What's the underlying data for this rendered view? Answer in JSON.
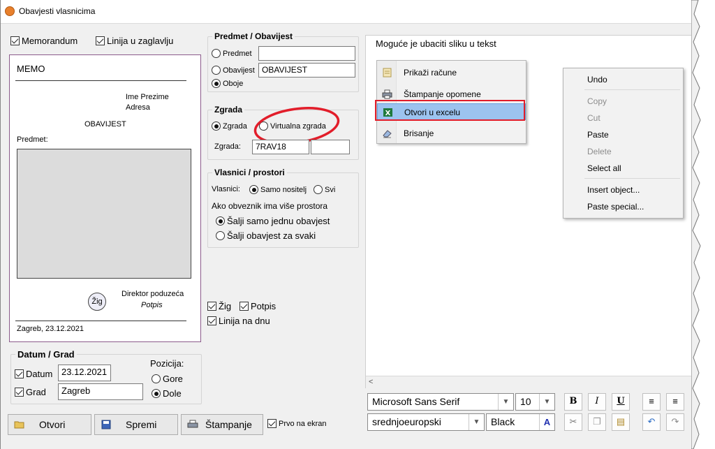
{
  "window": {
    "title": "Obavjesti vlasnicima"
  },
  "top_checks": {
    "memorandum": "Memorandum",
    "linija_zaglavlju": "Linija u zaglavlju"
  },
  "memo": {
    "header": "MEMO",
    "name": "Ime Prezime",
    "address": "Adresa",
    "doc_title": "OBAVIJEST",
    "subject_label": "Predmet:",
    "stamp": "Žig",
    "director": "Direktor poduzeća",
    "signature": "Potpis",
    "footer": "Zagreb, 23.12.2021"
  },
  "predmet_group": {
    "title": "Predmet / Obavijest",
    "opt_predmet": "Predmet",
    "opt_obavijest": "Obavijest",
    "opt_oboje": "Oboje",
    "obavijest_value": "OBAVIJEST"
  },
  "zgrada_group": {
    "title": "Zgrada",
    "opt_zgrada": "Zgrada",
    "opt_virtualna": "Virtualna zgrada",
    "field_label": "Zgrada:",
    "field_value": "7RAV18"
  },
  "vlasnici_group": {
    "title": "Vlasnici / prostori",
    "vlasnici_label": "Vlasnici:",
    "opt_samo_nositelj": "Samo nositelj",
    "opt_svi": "Svi",
    "info": "Ako obveznik ima više prostora",
    "opt_jedna": "Šalji samo jednu obavjest",
    "opt_svaki": "Šalji obavjest za svaki"
  },
  "stamp_checks": {
    "zig": "Žig",
    "potpis": "Potpis",
    "linija_dnu": "Linija na dnu"
  },
  "datum_group": {
    "title": "Datum / Grad",
    "datum_label": "Datum",
    "datum_value": "23.12.2021",
    "grad_label": "Grad",
    "grad_value": "Zagreb",
    "pozicija": "Pozicija:",
    "opt_gore": "Gore",
    "opt_dole": "Dole"
  },
  "editor": {
    "text": "Moguće je ubaciti sliku u tekst"
  },
  "context_menu_custom": [
    "Prikaži račune",
    "Štampanje opomene",
    "Otvori u excelu",
    "Brisanje"
  ],
  "context_menu_edit": {
    "undo": "Undo",
    "copy": "Copy",
    "cut": "Cut",
    "paste": "Paste",
    "delete": "Delete",
    "select_all": "Select all",
    "insert_object": "Insert object...",
    "paste_special": "Paste special..."
  },
  "bottom_buttons": {
    "otvori": "Otvori",
    "spremi": "Spremi",
    "stampanje": "Štampanje",
    "prvo_na_ekran": "Prvo na ekran"
  },
  "format": {
    "font": "Microsoft Sans Serif",
    "size": "10",
    "charset": "srednjoeuropski",
    "color": "Black",
    "bold": "B",
    "italic": "I",
    "underline": "U"
  },
  "colors": {
    "highlight_border": "#e21d2a",
    "menu_highlight": "#9cc3ef"
  }
}
